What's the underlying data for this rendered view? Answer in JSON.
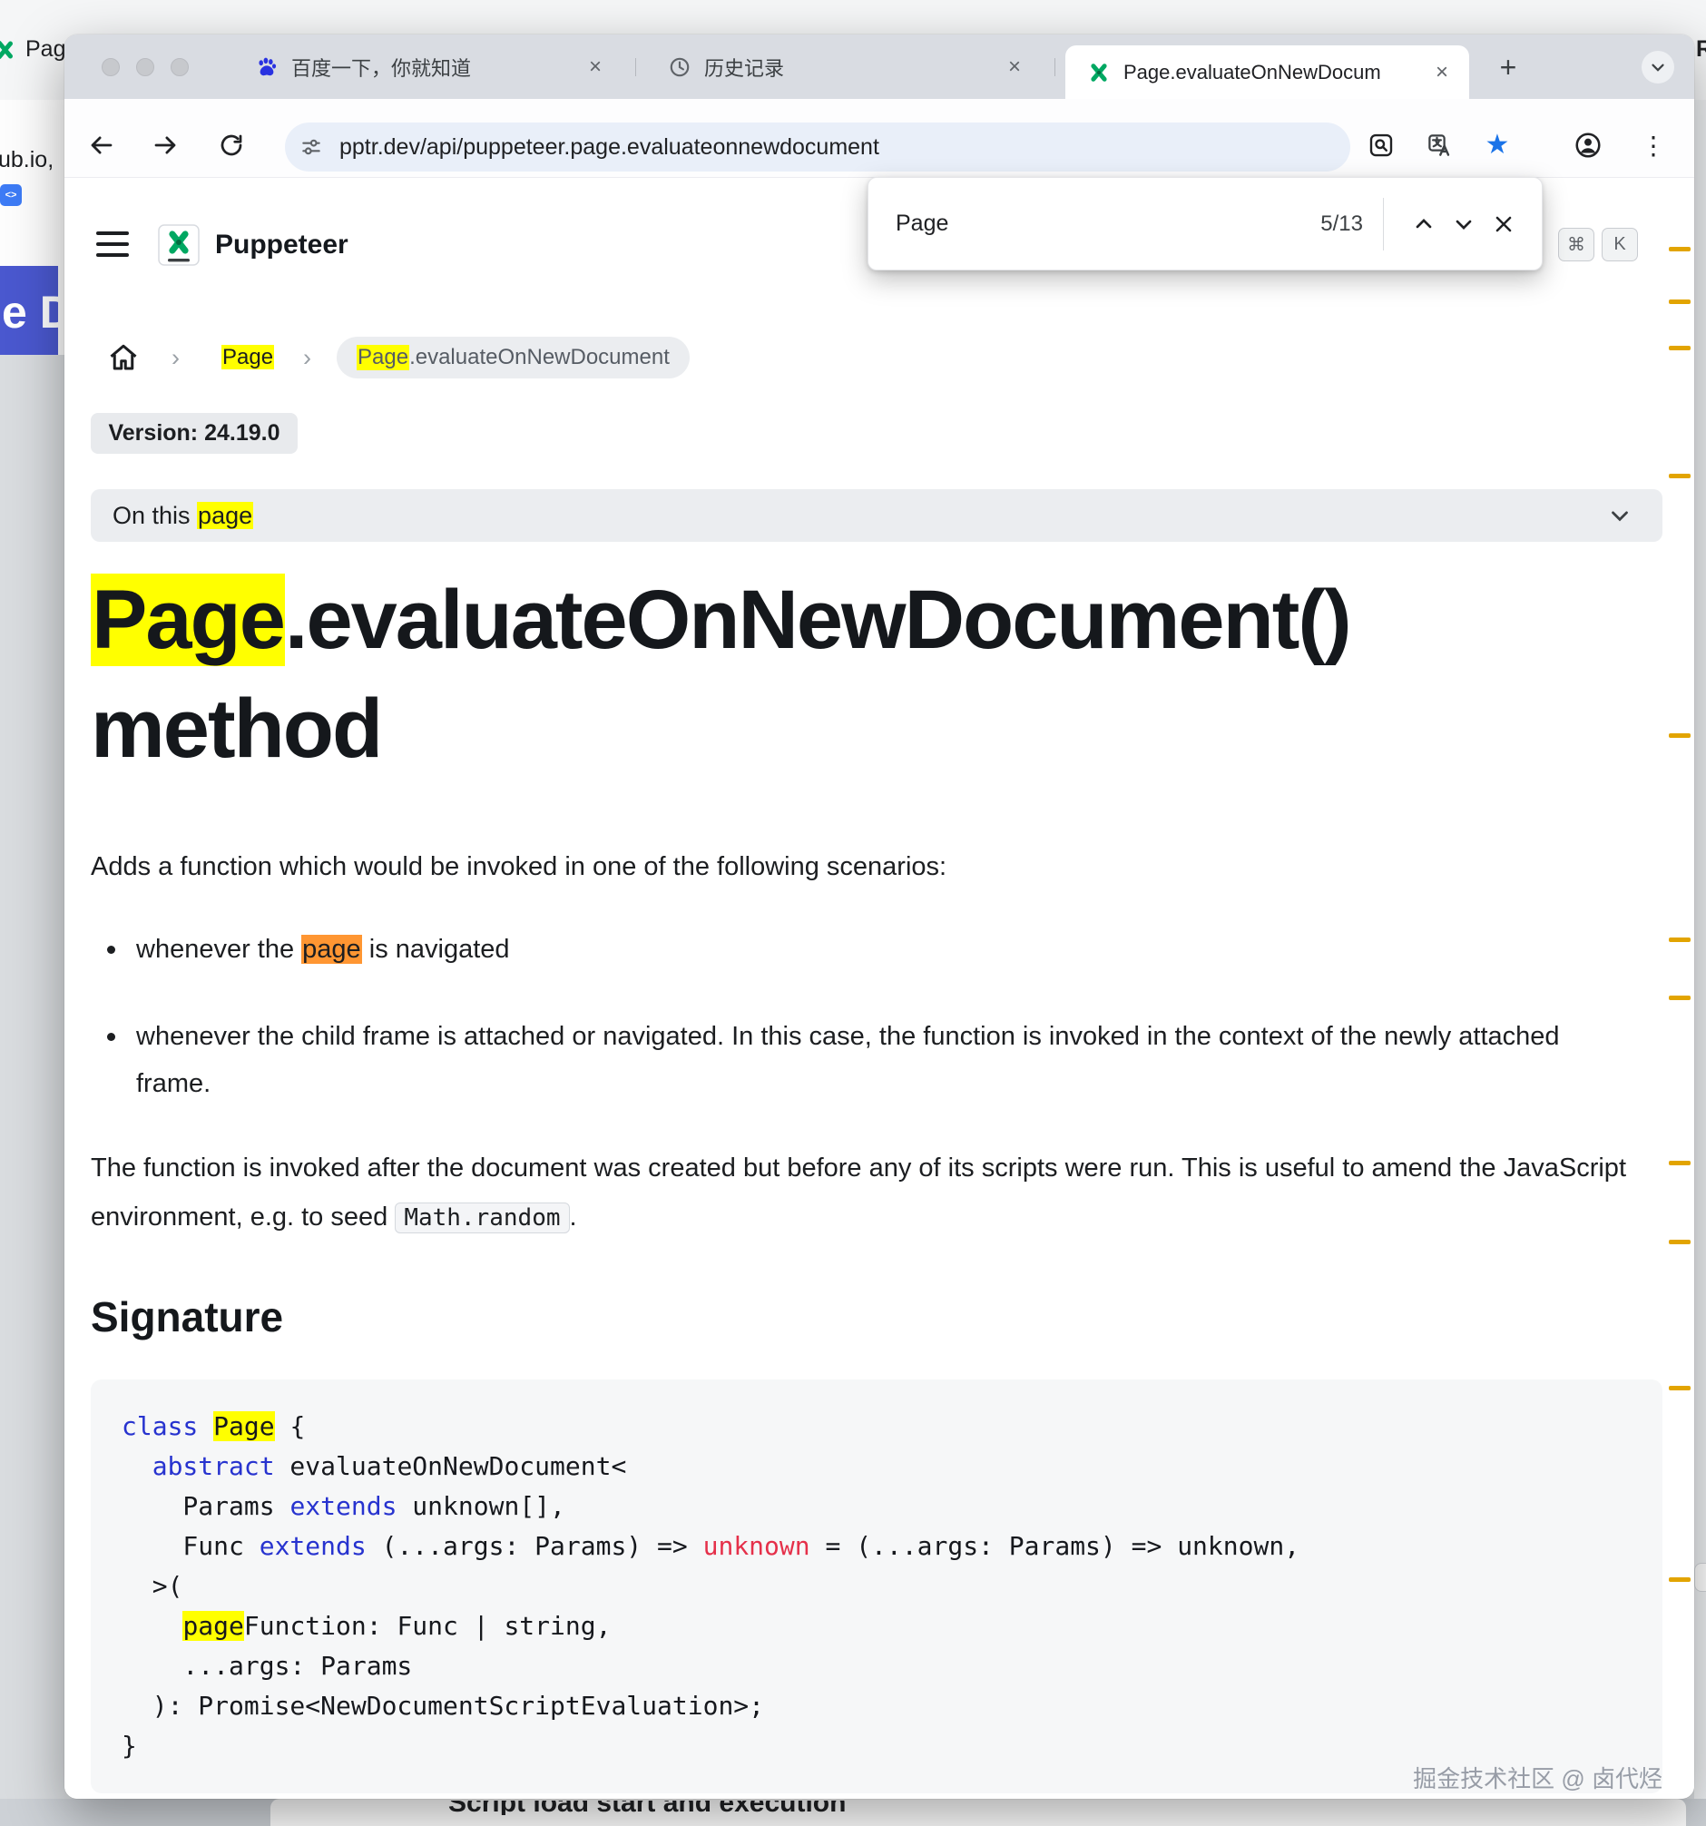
{
  "background": {
    "top_left_tab_fragment": "Pag",
    "top_right_fragment": "R",
    "url_fragment": "ub.io,",
    "blue_banner_text": "e D",
    "bottom_fragment": "Script load start and execution"
  },
  "browser": {
    "tabs": [
      {
        "title": "百度一下，你就知道"
      },
      {
        "title": "历史记录"
      },
      {
        "title": "Page.evaluateOnNewDocum"
      }
    ],
    "new_tab_label": "+",
    "address_url": "pptr.dev/api/puppeteer.page.evaluateonnewdocument",
    "find": {
      "query": "Page",
      "matches": "5/13"
    }
  },
  "docs": {
    "brand": "Puppeteer",
    "kbd": [
      "⌘",
      "K"
    ],
    "breadcrumb": {
      "page_link": "Page",
      "current_highlight": "Page",
      "current_rest": ".evaluateOnNewDocument"
    },
    "version": "Version: 24.19.0",
    "toc_pre": "On this ",
    "toc_hl": "page",
    "h1_hl": "Page",
    "h1_rest": ".evaluateOnNewDocument()",
    "h1_line2": "method",
    "intro": "Adds a function which would be invoked in one of the following scenarios:",
    "bullet1_pre": "whenever the ",
    "bullet1_hl": "page",
    "bullet1_post": " is navigated",
    "bullet2": "whenever the child frame is attached or navigated. In this case, the function is invoked in the context of the newly attached frame.",
    "para2_pre": "The function is invoked after the document was created but before any of its scripts were run. This is useful to amend the JavaScript environment, e.g. to seed ",
    "para2_code": "Math.random",
    "para2_post": ".",
    "signature": "Signature",
    "watermark": "掘金技术社区 @ 卤代烃"
  },
  "code": {
    "lines": [
      [
        {
          "t": "class",
          "c": "kw"
        },
        {
          "t": " "
        },
        {
          "t": "Page",
          "h": true
        },
        {
          "t": " {"
        }
      ],
      [
        {
          "t": "  "
        },
        {
          "t": "abstract",
          "c": "kw"
        },
        {
          "t": " evaluateOnNewDocument<"
        }
      ],
      [
        {
          "t": "    Params "
        },
        {
          "t": "extends",
          "c": "kw"
        },
        {
          "t": " unknown[],"
        }
      ],
      [
        {
          "t": "    Func "
        },
        {
          "t": "extends",
          "c": "kw"
        },
        {
          "t": " (...args: Params) => "
        },
        {
          "t": "unknown",
          "c": "red"
        },
        {
          "t": " = (...args: Params) => unknown,"
        }
      ],
      [
        {
          "t": "  >("
        }
      ],
      [
        {
          "t": "    "
        },
        {
          "t": "page",
          "h": true
        },
        {
          "t": "Function: Func | string,"
        }
      ],
      [
        {
          "t": "    ...args: Params"
        }
      ],
      [
        {
          "t": "  ): Promise<NewDocumentScriptEvaluation>;"
        }
      ],
      [
        {
          "t": "}"
        }
      ]
    ]
  }
}
